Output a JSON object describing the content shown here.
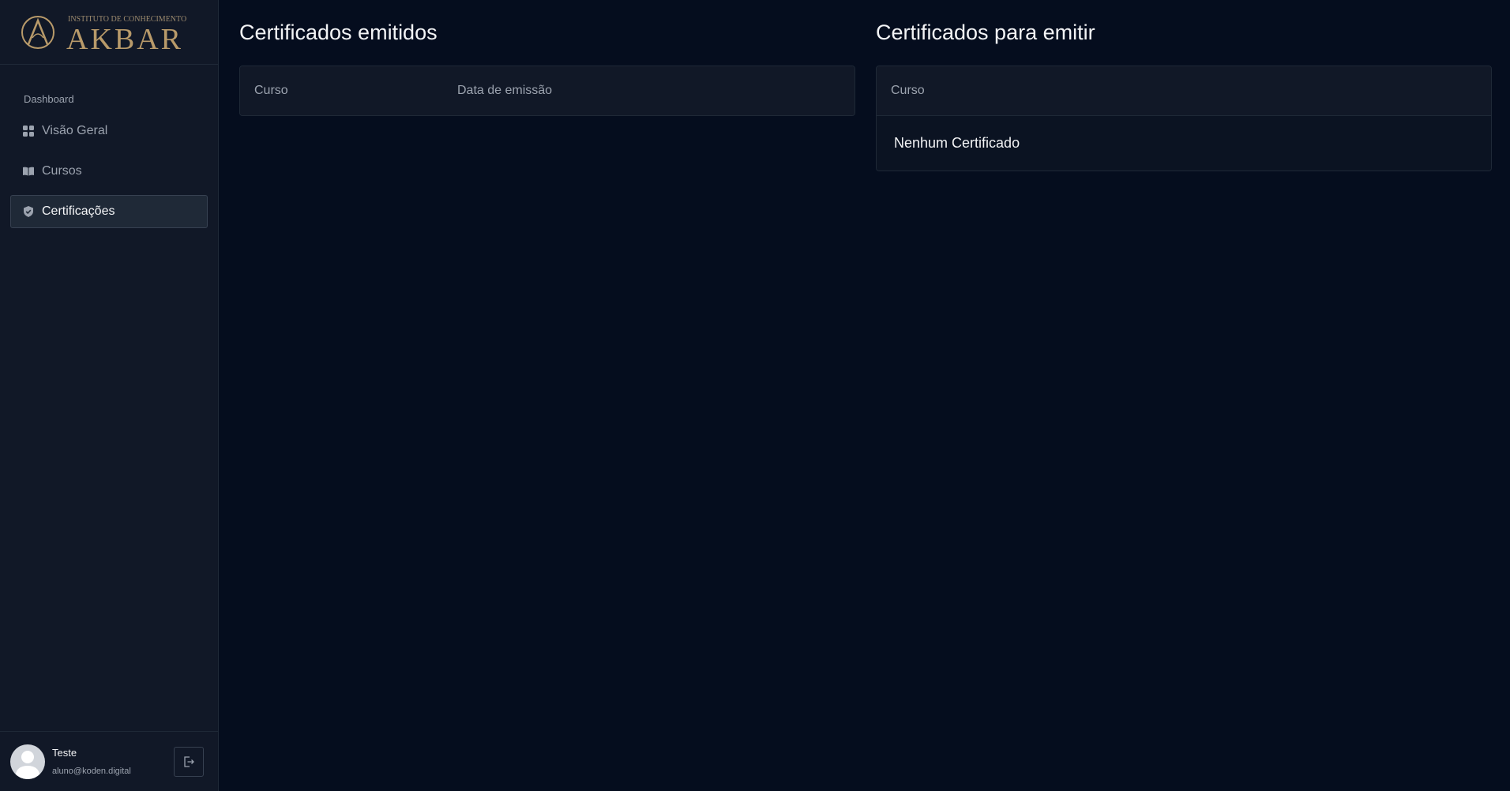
{
  "brand": {
    "logo_tagline": "INSTITUTO DE CONHECIMENTO",
    "logo_name": "AKBAR"
  },
  "sidebar": {
    "section_label": "Dashboard",
    "items": [
      {
        "label": "Visão Geral",
        "icon": "grid-icon",
        "active": false
      },
      {
        "label": "Cursos",
        "icon": "book-icon",
        "active": false
      },
      {
        "label": "Certificações",
        "icon": "shield-icon",
        "active": true
      }
    ]
  },
  "user": {
    "name": "Teste",
    "email": "aluno@koden.digital"
  },
  "issued": {
    "title": "Certificados emitidos",
    "columns": [
      "Curso",
      "Data de emissão"
    ],
    "rows": []
  },
  "pending": {
    "title": "Certificados para emitir",
    "columns": [
      "Curso"
    ],
    "empty_message": "Nenhum Certificado"
  },
  "colors": {
    "background": "#050d1e",
    "sidebar": "#111827",
    "logo_gold": "#b89a6a"
  }
}
